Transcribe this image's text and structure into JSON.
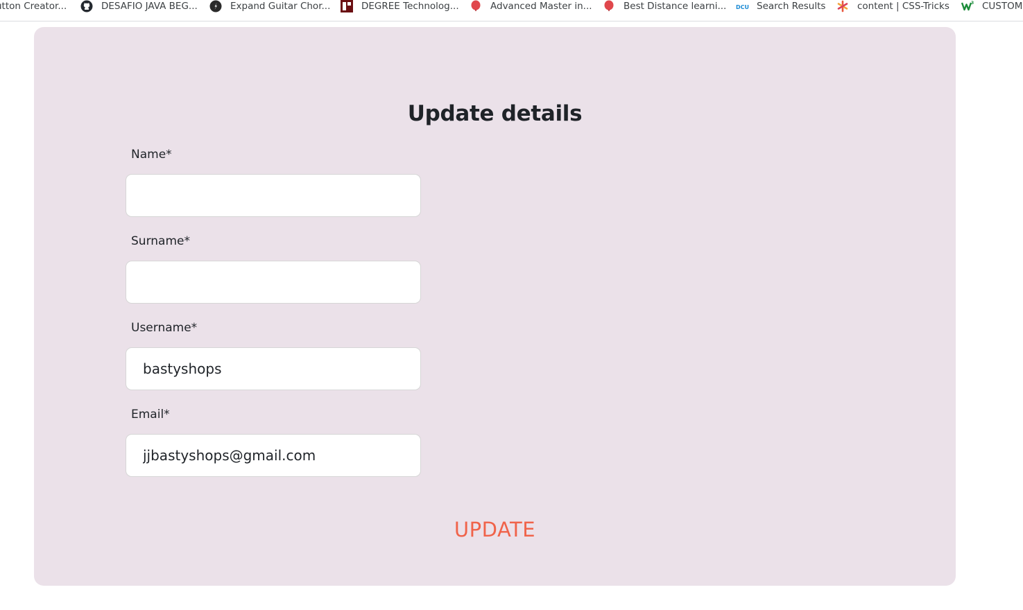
{
  "bookmarks": [
    {
      "label": "utton Creator...",
      "icon": "none"
    },
    {
      "label": "DESAFIO JAVA BEG...",
      "icon": "github-icon"
    },
    {
      "label": "Expand Guitar Chor...",
      "icon": "guitar-site-icon"
    },
    {
      "label": "DEGREE Technolog...",
      "icon": "degree-site-icon"
    },
    {
      "label": "Advanced Master in...",
      "icon": "balloon-icon"
    },
    {
      "label": "Best Distance learni...",
      "icon": "balloon-icon"
    },
    {
      "label": "Search Results",
      "icon": "dcu-icon"
    },
    {
      "label": "content | CSS-Tricks",
      "icon": "asterisk-icon"
    },
    {
      "label": "CUSTOM",
      "icon": "w-icon"
    }
  ],
  "form": {
    "title": "Update details",
    "fields": [
      {
        "label": "Name*",
        "value": "",
        "placeholder": ""
      },
      {
        "label": "Surname*",
        "value": "",
        "placeholder": ""
      },
      {
        "label": "Username*",
        "value": "bastyshops",
        "placeholder": ""
      },
      {
        "label": "Email*",
        "value": "jjbastyshops@gmail.com",
        "placeholder": ""
      }
    ],
    "submit_label": "UPDATE"
  },
  "colors": {
    "card_background": "#ebe1e9",
    "accent": "#f0634a",
    "text": "#1f2328"
  }
}
